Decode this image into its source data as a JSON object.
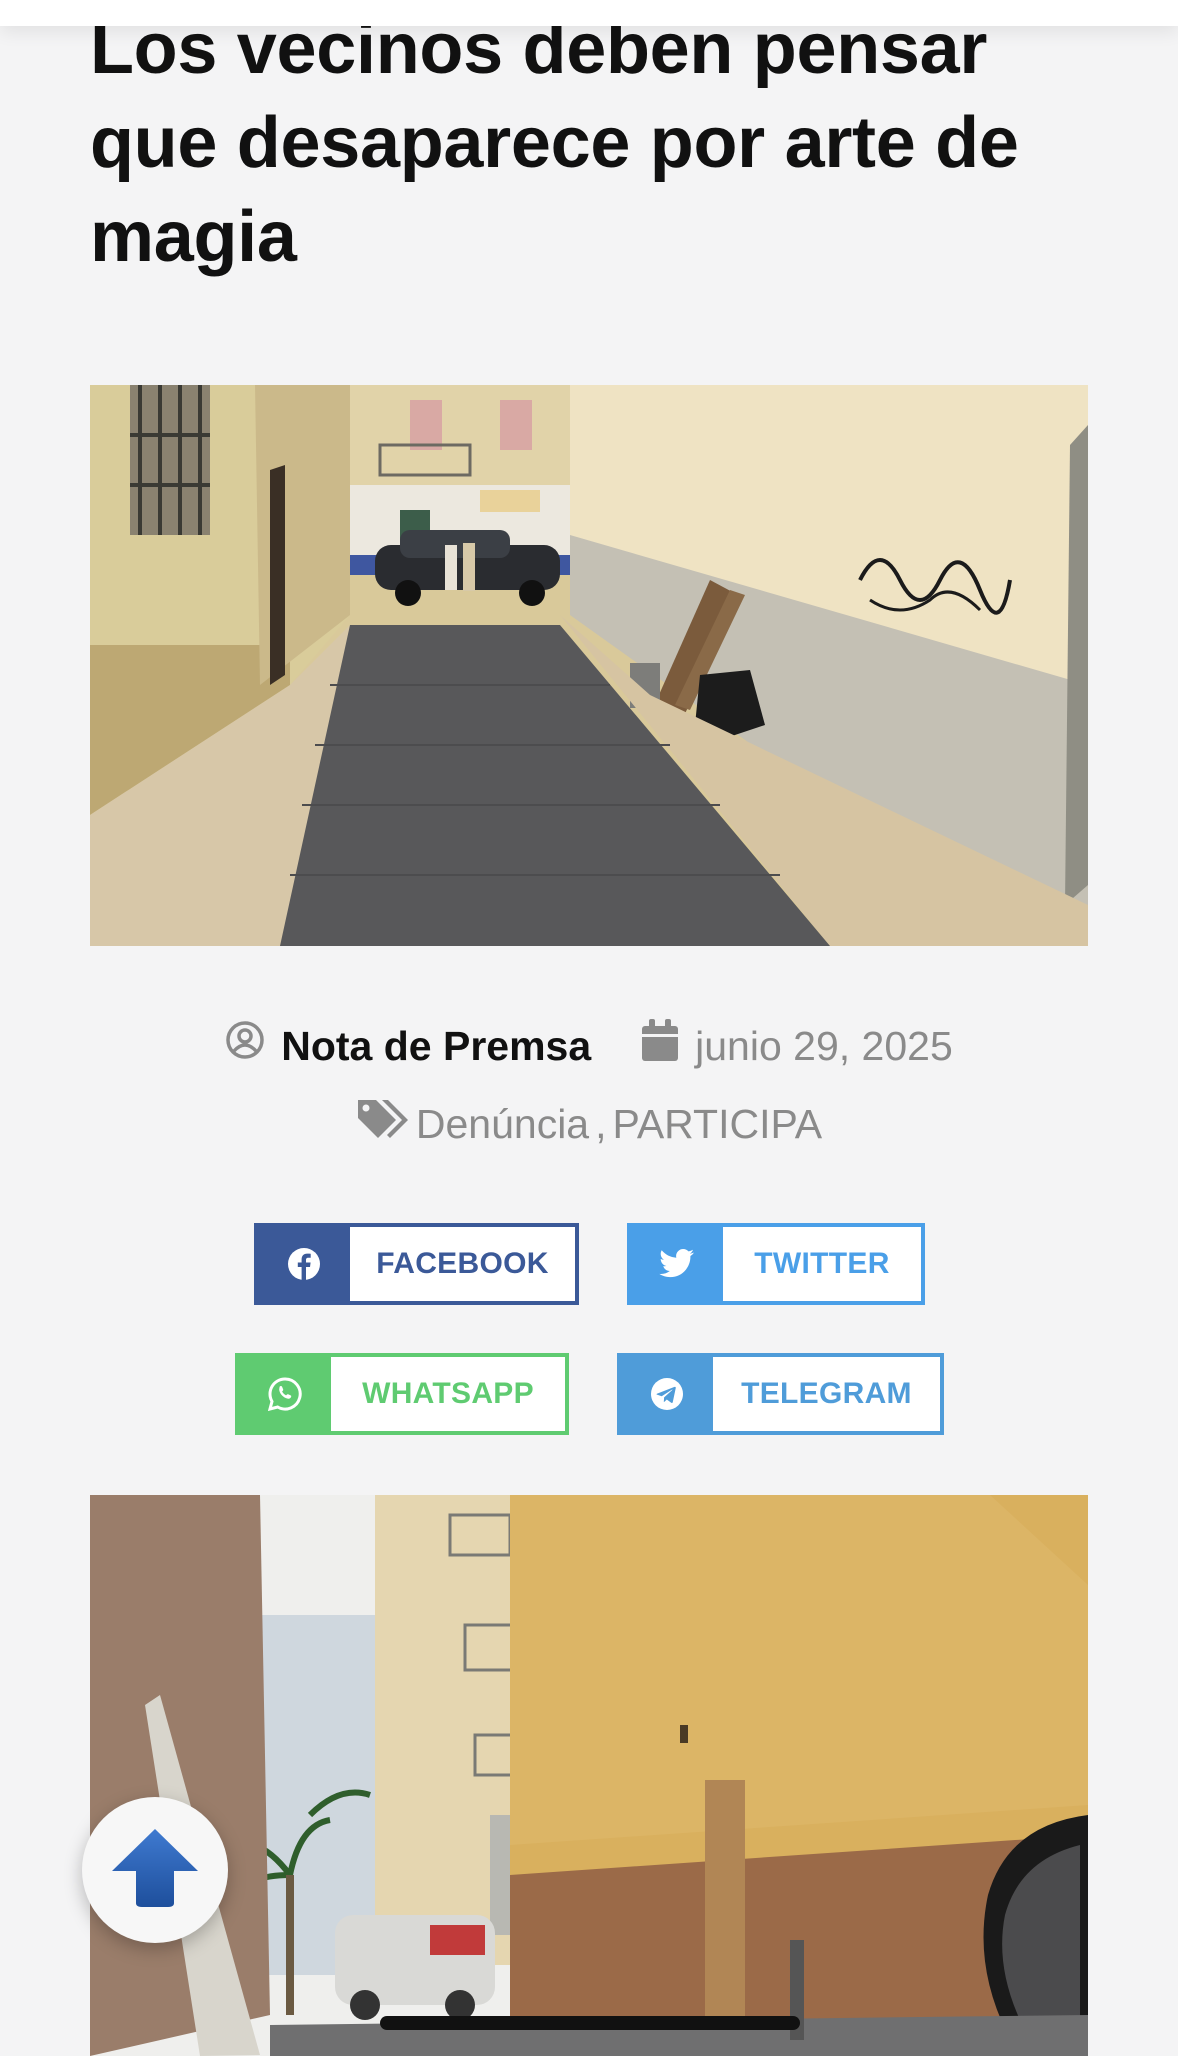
{
  "article": {
    "title": "Los vecinos deben pensar que desaparece por arte de magia"
  },
  "meta": {
    "author": "Nota de Premsa",
    "date": "junio 29, 2025",
    "categories": [
      "Denúncia",
      "PARTICIPA"
    ],
    "category_separator": ","
  },
  "share": {
    "facebook": "FACEBOOK",
    "twitter": "TWITTER",
    "whatsapp": "WHATSAPP",
    "telegram": "TELEGRAM"
  },
  "colors": {
    "facebook": "#3b5998",
    "twitter": "#4a9fe8",
    "whatsapp": "#5fcb71",
    "telegram": "#4f9cd9",
    "meta_gray": "#8a8a8a"
  },
  "icons": {
    "author": "user-circle-icon",
    "date": "calendar-icon",
    "tags": "tags-icon",
    "scroll": "arrow-up-icon"
  }
}
